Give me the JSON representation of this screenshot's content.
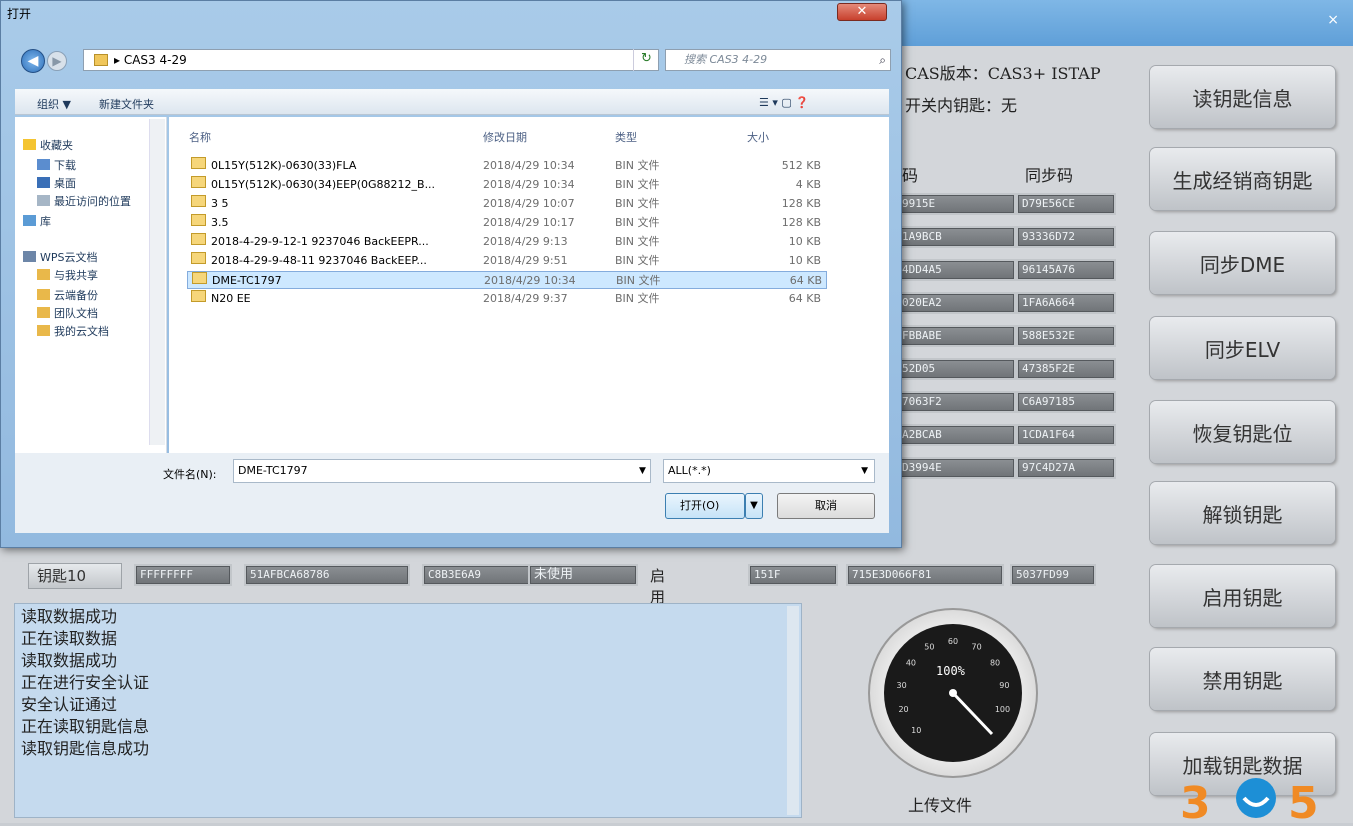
{
  "app": {
    "close_icon": "×",
    "cas_version": "CAS版本：CAS3+ ISTAP",
    "switch_key": "开关内钥匙：无",
    "col_code": "码",
    "col_sync": "同步码",
    "code_rows": [
      {
        "a": "9915E",
        "b": "D79E56CE"
      },
      {
        "a": "1A9BCB",
        "b": "93336D72"
      },
      {
        "a": "4DD4A5",
        "b": "96145A76"
      },
      {
        "a": "020EA2",
        "b": "1FA6A664"
      },
      {
        "a": "FBBABE",
        "b": "588E532E"
      },
      {
        "a": "52D05",
        "b": "47385F2E"
      },
      {
        "a": "7063F2",
        "b": "C6A97185"
      },
      {
        "a": "A2BCAB",
        "b": "1CDA1F64"
      },
      {
        "a": "D3994E",
        "b": "97C4D27A"
      }
    ],
    "buttons": [
      "读钥匙信息",
      "生成经销商钥匙",
      "同步DME",
      "同步ELV",
      "恢复钥匙位",
      "解锁钥匙",
      "启用钥匙",
      "禁用钥匙",
      "加载钥匙数据"
    ],
    "key10": {
      "label": "钥匙10",
      "c1": "FFFFFFFF",
      "c2": "51AFBCA68786",
      "c3": "C8B3E6A9",
      "c4": "未使用",
      "status": "启用",
      "c5": "151F",
      "c6": "715E3D066F81",
      "c7": "5037FD99"
    },
    "log": [
      "读取数据成功",
      "正在读取数据",
      "读取数据成功",
      "正在进行安全认证",
      "安全认证通过",
      "正在读取钥匙信息",
      "读取钥匙信息成功"
    ],
    "gauge_value": "100%",
    "gauge_ticks": [
      "10",
      "20",
      "30",
      "40",
      "50",
      "60",
      "70",
      "80",
      "90",
      "100"
    ],
    "upload_label": "上传文件",
    "logo": "365"
  },
  "dialog": {
    "title": "打开",
    "close_icon": "✕",
    "back_icon": "◀",
    "forward_icon": "▶",
    "address": "▸ CAS3 4-29",
    "refresh_icon": "↻",
    "search_placeholder": "搜索 CAS3 4-29",
    "search_icon": "⌕",
    "organize": "组织 ▼",
    "new_folder": "新建文件夹",
    "view_icons": "☰ ▾   ▢   ❓",
    "sidebar": [
      "收藏夹",
      "下载",
      "桌面",
      "最近访问的位置",
      "库",
      "WPS云文档",
      "与我共享",
      "云端备份",
      "团队文档",
      "我的云文档"
    ],
    "columns": {
      "name": "名称",
      "date": "修改日期",
      "type": "类型",
      "size": "大小"
    },
    "files": [
      {
        "name": "0L15Y(512K)-0630(33)FLA",
        "date": "2018/4/29 10:34",
        "type": "BIN 文件",
        "size": "512 KB"
      },
      {
        "name": "0L15Y(512K)-0630(34)EEP(0G88212_B...",
        "date": "2018/4/29 10:34",
        "type": "BIN 文件",
        "size": "4 KB"
      },
      {
        "name": "3 5",
        "date": "2018/4/29 10:07",
        "type": "BIN 文件",
        "size": "128 KB"
      },
      {
        "name": "3.5",
        "date": "2018/4/29 10:17",
        "type": "BIN 文件",
        "size": "128 KB"
      },
      {
        "name": "2018-4-29-9-12-1 9237046 BackEEPR...",
        "date": "2018/4/29 9:13",
        "type": "BIN 文件",
        "size": "10 KB"
      },
      {
        "name": "2018-4-29-9-48-11 9237046 BackEEP...",
        "date": "2018/4/29 9:51",
        "type": "BIN 文件",
        "size": "10 KB"
      },
      {
        "name": "DME-TC1797",
        "date": "2018/4/29 10:34",
        "type": "BIN 文件",
        "size": "64 KB"
      },
      {
        "name": "N20 EE",
        "date": "2018/4/29 9:37",
        "type": "BIN 文件",
        "size": "64 KB"
      }
    ],
    "selected_index": 6,
    "filename_label": "文件名(N):",
    "filename_value": "DME-TC1797",
    "filetype_value": "ALL(*.*)",
    "open_label": "打开(O)",
    "cancel_label": "取消"
  }
}
